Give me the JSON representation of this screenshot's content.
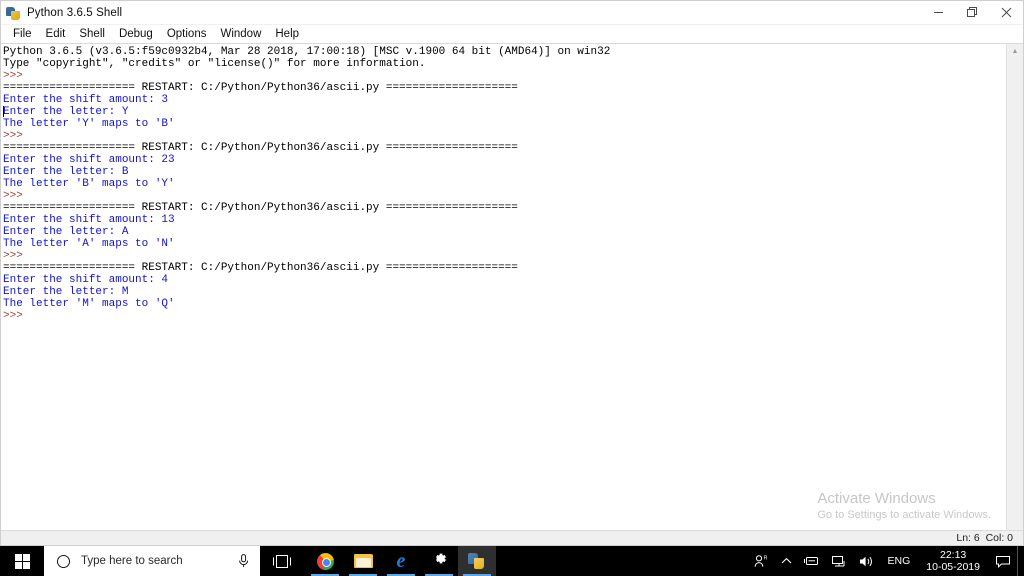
{
  "window": {
    "title": "Python 3.6.5 Shell",
    "icon": "python-logo-icon",
    "controls": {
      "minimize": "minimize-button",
      "restore": "restore-button",
      "close": "close-button"
    }
  },
  "menubar": {
    "items": [
      {
        "label": "File"
      },
      {
        "label": "Edit"
      },
      {
        "label": "Shell"
      },
      {
        "label": "Debug"
      },
      {
        "label": "Options"
      },
      {
        "label": "Window"
      },
      {
        "label": "Help"
      }
    ]
  },
  "console": {
    "lines": [
      {
        "text": "Python 3.6.5 (v3.6.5:f59c0932b4, Mar 28 2018, 17:00:18) [MSC v.1900 64 bit (AMD64)] on win32",
        "color": "black"
      },
      {
        "text": "Type \"copyright\", \"credits\" or \"license()\" for more information.",
        "color": "black"
      },
      {
        "text": ">>> ",
        "color": "prompt"
      },
      {
        "text": "==================== RESTART: C:/Python/Python36/ascii.py ====================",
        "color": "black"
      },
      {
        "text": "Enter the shift amount: 3",
        "color": "blue"
      },
      {
        "text": "Enter the letter: Y",
        "color": "blue"
      },
      {
        "text": "The letter 'Y' maps to 'B'",
        "color": "blue"
      },
      {
        "text": ">>> ",
        "color": "prompt"
      },
      {
        "text": "==================== RESTART: C:/Python/Python36/ascii.py ====================",
        "color": "black"
      },
      {
        "text": "Enter the shift amount: 23",
        "color": "blue"
      },
      {
        "text": "Enter the letter: B",
        "color": "blue"
      },
      {
        "text": "The letter 'B' maps to 'Y'",
        "color": "blue"
      },
      {
        "text": ">>> ",
        "color": "prompt"
      },
      {
        "text": "==================== RESTART: C:/Python/Python36/ascii.py ====================",
        "color": "black"
      },
      {
        "text": "Enter the shift amount: 13",
        "color": "blue"
      },
      {
        "text": "Enter the letter: A",
        "color": "blue"
      },
      {
        "text": "The letter 'A' maps to 'N'",
        "color": "blue"
      },
      {
        "text": ">>> ",
        "color": "prompt"
      },
      {
        "text": "==================== RESTART: C:/Python/Python36/ascii.py ====================",
        "color": "black"
      },
      {
        "text": "Enter the shift amount: 4",
        "color": "blue"
      },
      {
        "text": "Enter the letter: M",
        "color": "blue"
      },
      {
        "text": "The letter 'M' maps to 'Q'",
        "color": "blue"
      },
      {
        "text": ">>> ",
        "color": "prompt"
      }
    ],
    "caret_line_index": 5,
    "colors": {
      "output_black": "#000000",
      "stdout_blue": "#1414c8",
      "prompt_brown": "#a03c3c"
    }
  },
  "statusbar": {
    "position": "Ln: 6  Col: 0"
  },
  "watermark": {
    "title": "Activate Windows",
    "subtitle": "Go to Settings to activate Windows."
  },
  "taskbar": {
    "start": "start-button",
    "search": {
      "placeholder": "Type here to search",
      "mic": "microphone-icon",
      "cortana": "cortana-circle-icon"
    },
    "taskview": "task-view-icon",
    "apps": [
      {
        "name": "google-chrome",
        "active": false,
        "running": true
      },
      {
        "name": "file-explorer",
        "active": false,
        "running": true
      },
      {
        "name": "microsoft-edge",
        "active": false,
        "running": true
      },
      {
        "name": "settings",
        "active": false,
        "running": true
      },
      {
        "name": "python-idle",
        "active": true,
        "running": true
      }
    ],
    "tray": {
      "people": "people-icon",
      "chevron": "show-hidden-icons-chevron",
      "pen": "pen-workspace-icon",
      "network": "network-icon",
      "volume": "volume-icon",
      "language": "ENG",
      "time": "22:13",
      "date": "10-05-2019",
      "action_center": "action-center-icon"
    }
  }
}
